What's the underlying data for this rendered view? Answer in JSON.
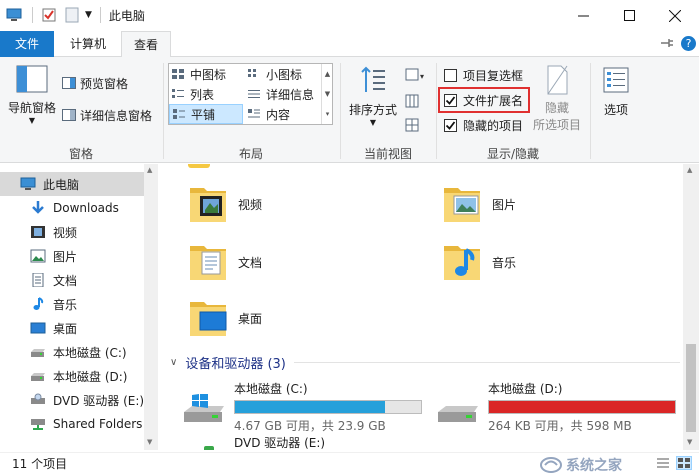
{
  "window": {
    "title": "此电脑",
    "controls": [
      "minimize",
      "maximize",
      "close"
    ]
  },
  "ribbon_tabs": [
    "文件",
    "计算机",
    "查看"
  ],
  "ribbon": {
    "panes": {
      "nav_pane": "导航窗格",
      "preview_pane": "预览窗格",
      "details_pane": "详细信息窗格",
      "group_label": "窗格"
    },
    "layout": {
      "items": [
        "中图标",
        "小图标",
        "列表",
        "详细信息",
        "平铺",
        "内容"
      ],
      "selected": "平铺",
      "group_label": "布局"
    },
    "current_view": {
      "sort": "排序方式",
      "group_label": "当前视图"
    },
    "show_hide": {
      "item_checkboxes": "项目复选框",
      "file_extensions": "文件扩展名",
      "hidden_items": "隐藏的项目",
      "hide_selected_top": "隐藏",
      "hide_selected_bottom": "所选项目",
      "group_label": "显示/隐藏",
      "item_checkboxes_checked": false,
      "file_extensions_checked": true,
      "hidden_items_checked": true,
      "highlight_color": "#e03030"
    },
    "options": "选项"
  },
  "nav": {
    "items": [
      {
        "label": "此电脑",
        "icon": "computer-icon",
        "selected": true
      },
      {
        "label": "Downloads",
        "icon": "download-arrow-icon"
      },
      {
        "label": "视频",
        "icon": "video-icon"
      },
      {
        "label": "图片",
        "icon": "picture-icon"
      },
      {
        "label": "文档",
        "icon": "document-icon"
      },
      {
        "label": "音乐",
        "icon": "music-note-icon"
      },
      {
        "label": "桌面",
        "icon": "desktop-icon"
      },
      {
        "label": "本地磁盘 (C:)",
        "icon": "hard-drive-icon"
      },
      {
        "label": "本地磁盘 (D:)",
        "icon": "hard-drive-icon"
      },
      {
        "label": "DVD 驱动器 (E:)",
        "icon": "dvd-drive-icon"
      },
      {
        "label": "Shared Folders",
        "icon": "network-drive-icon"
      }
    ]
  },
  "folders": [
    {
      "label": "视频",
      "icon": "video-folder-icon"
    },
    {
      "label": "图片",
      "icon": "picture-folder-icon"
    },
    {
      "label": "文档",
      "icon": "document-folder-icon"
    },
    {
      "label": "音乐",
      "icon": "music-folder-icon"
    },
    {
      "label": "桌面",
      "icon": "desktop-folder-icon"
    }
  ],
  "devices": {
    "header": "设备和驱动器 (3)",
    "drives": [
      {
        "label": "本地磁盘 (C:)",
        "info": "4.67 GB 可用，共 23.9 GB",
        "used_fraction": 0.805,
        "bar_color": "#26a0da"
      },
      {
        "label": "本地磁盘 (D:)",
        "info": "264 KB 可用，共 598 MB",
        "used_fraction": 0.9996,
        "bar_color": "#da2626"
      },
      {
        "label": "DVD 驱动器 (E:)"
      }
    ]
  },
  "status": {
    "item_count": "11 个项目"
  },
  "watermark": "系统之家"
}
